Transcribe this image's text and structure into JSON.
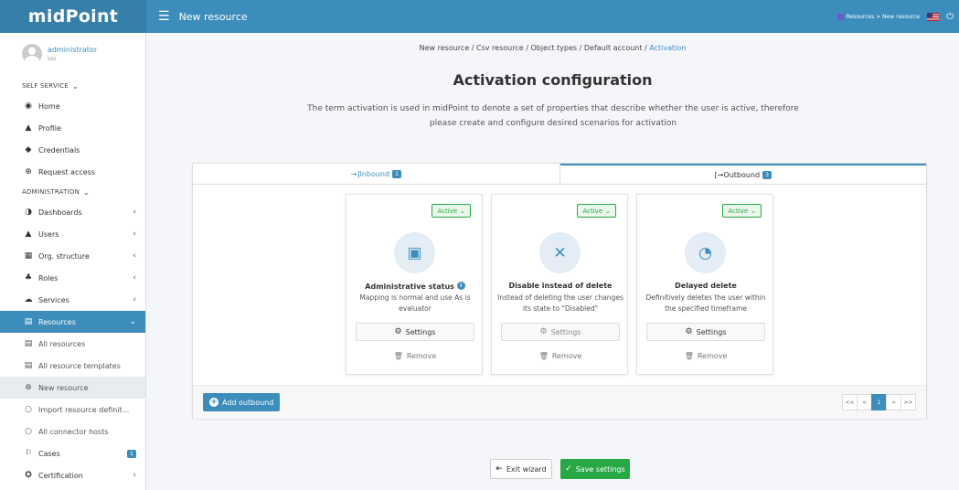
{
  "header": {
    "brand": "midPoint",
    "menu_icon": "hamburger-icon",
    "page_title": "New resource",
    "crumb": "Resources > New resource",
    "power_icon": "power-icon"
  },
  "user": {
    "name": "administrator",
    "sub": "sss"
  },
  "sidebar": {
    "self_service": "SELF SERVICE",
    "administration": "ADMINISTRATION",
    "self_items": [
      {
        "icon": "home-icon",
        "glyph": "◉",
        "label": "Home"
      },
      {
        "icon": "profile-icon",
        "glyph": "▲",
        "label": "Profile"
      },
      {
        "icon": "shield-icon",
        "glyph": "◆",
        "label": "Credentials"
      },
      {
        "icon": "plus-circle-icon",
        "glyph": "⊕",
        "label": "Request access"
      }
    ],
    "admin_items": [
      {
        "icon": "dashboard-icon",
        "glyph": "◑",
        "label": "Dashboards"
      },
      {
        "icon": "user-icon",
        "glyph": "▲",
        "label": "Users"
      },
      {
        "icon": "building-icon",
        "glyph": "▦",
        "label": "Org. structure"
      },
      {
        "icon": "roles-icon",
        "glyph": "♣",
        "label": "Roles"
      },
      {
        "icon": "cloud-icon",
        "glyph": "☁",
        "label": "Services"
      },
      {
        "icon": "database-icon",
        "glyph": "▤",
        "label": "Resources"
      }
    ],
    "resource_items": [
      {
        "icon": "database-icon",
        "glyph": "▤",
        "label": "All resources"
      },
      {
        "icon": "database-icon",
        "glyph": "▤",
        "label": "All resource templates"
      },
      {
        "icon": "plus-circle-icon",
        "glyph": "⊕",
        "label": "New resource"
      },
      {
        "icon": "circle-icon",
        "glyph": "○",
        "label": "Import resource definit..."
      },
      {
        "icon": "circle-icon",
        "glyph": "○",
        "label": "All connector hosts"
      }
    ],
    "cases": {
      "icon": "cases-icon",
      "glyph": "⚐",
      "label": "Cases",
      "badge": "1"
    },
    "certification": {
      "icon": "certification-icon",
      "glyph": "✪",
      "label": "Certification"
    }
  },
  "breadcrumb": {
    "items": [
      "New resource",
      "Csv resource",
      "Object types",
      "Default account"
    ],
    "current": "Activation",
    "sep": " / "
  },
  "title": "Activation configuration",
  "subtitle": "The term activation is used in midPoint to denote a set of properties that describe whether the user is active, therefore please create and configure desired scenarios for activation",
  "tabs": {
    "inbound": {
      "label": "Inbound",
      "count": "1",
      "icon": "sign-in-icon"
    },
    "outbound": {
      "label": "Outbound",
      "count": "3",
      "icon": "sign-out-icon"
    }
  },
  "cards": [
    {
      "select": "Active",
      "icon": "id-badge-icon",
      "glyph": "▣",
      "title": "Administrative status",
      "has_info": true,
      "desc": "Mapping is normal and use As is evaluator",
      "settings": "Settings",
      "remove": "Remove",
      "settings_enabled": true
    },
    {
      "select": "Active",
      "icon": "user-slash-icon",
      "glyph": "✕",
      "title": "Disable instead of delete",
      "has_info": false,
      "desc": "Instead of deleting the user changes its state to \"Disabled\"",
      "settings": "Settings",
      "remove": "Remove",
      "settings_enabled": false
    },
    {
      "select": "Active",
      "icon": "clock-icon",
      "glyph": "◔",
      "title": "Delayed delete",
      "has_info": false,
      "desc": "Definitively deletes the user within the specified timeframe",
      "settings": "Settings",
      "remove": "Remove",
      "settings_enabled": true
    }
  ],
  "add_outbound": "Add outbound",
  "pager": [
    "<<",
    "<",
    "1",
    ">",
    ">>"
  ],
  "pager_current": "1",
  "buttons": {
    "exit": "Exit wizard",
    "save": "Save settings"
  },
  "colors": {
    "primary": "#3c8dbc",
    "brand_bg": "#367fa9",
    "success": "#28a745"
  }
}
